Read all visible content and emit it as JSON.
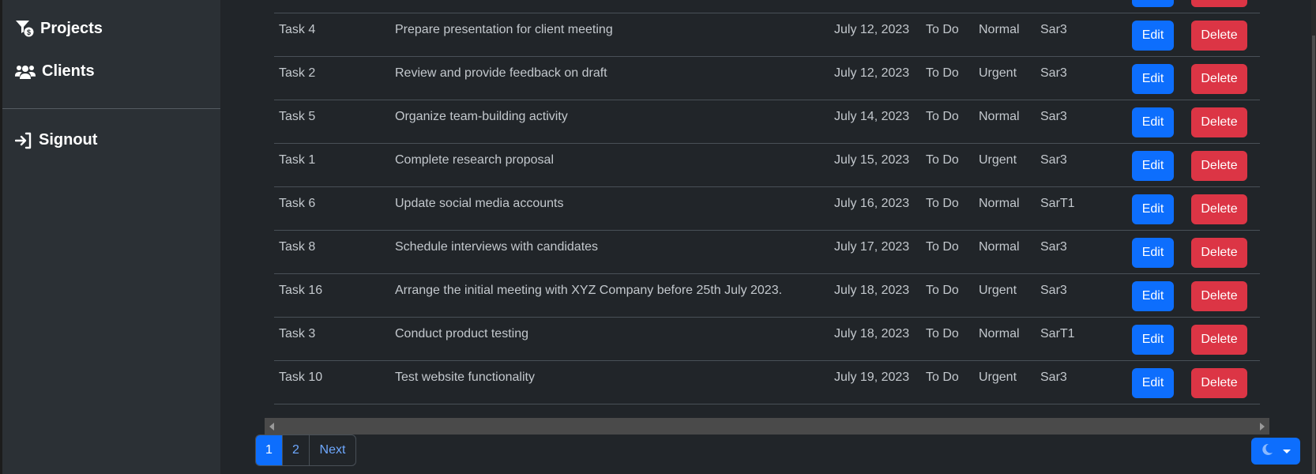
{
  "sidebar": {
    "items": [
      {
        "label": "Projects",
        "icon": "funnel-dollar-icon"
      },
      {
        "label": "Clients",
        "icon": "users-icon"
      },
      {
        "label": "Signout",
        "icon": "sign-in-icon"
      }
    ]
  },
  "table": {
    "rows": [
      {
        "name": "Task 4",
        "description": "Prepare presentation for client meeting",
        "due": "July 12, 2023",
        "status": "To Do",
        "priority": "Normal",
        "assignee": "Sar3"
      },
      {
        "name": "Task 2",
        "description": "Review and provide feedback on draft",
        "due": "July 12, 2023",
        "status": "To Do",
        "priority": "Urgent",
        "assignee": "Sar3"
      },
      {
        "name": "Task 5",
        "description": "Organize team-building activity",
        "due": "July 14, 2023",
        "status": "To Do",
        "priority": "Normal",
        "assignee": "Sar3"
      },
      {
        "name": "Task 1",
        "description": "Complete research proposal",
        "due": "July 15, 2023",
        "status": "To Do",
        "priority": "Urgent",
        "assignee": "Sar3"
      },
      {
        "name": "Task 6",
        "description": "Update social media accounts",
        "due": "July 16, 2023",
        "status": "To Do",
        "priority": "Normal",
        "assignee": "SarT1"
      },
      {
        "name": "Task 8",
        "description": "Schedule interviews with candidates",
        "due": "July 17, 2023",
        "status": "To Do",
        "priority": "Normal",
        "assignee": "Sar3"
      },
      {
        "name": "Task 16",
        "description": "Arrange the initial meeting with XYZ Company before 25th July 2023.",
        "due": "July 18, 2023",
        "status": "To Do",
        "priority": "Urgent",
        "assignee": "Sar3"
      },
      {
        "name": "Task 3",
        "description": "Conduct product testing",
        "due": "July 18, 2023",
        "status": "To Do",
        "priority": "Normal",
        "assignee": "SarT1"
      },
      {
        "name": "Task 10",
        "description": "Test website functionality",
        "due": "July 19, 2023",
        "status": "To Do",
        "priority": "Urgent",
        "assignee": "Sar3"
      }
    ],
    "edit_label": "Edit",
    "delete_label": "Delete"
  },
  "pagination": {
    "pages": [
      "1",
      "2"
    ],
    "active": "1",
    "next_label": "Next"
  },
  "theme_toggle": {
    "icon": "moon-icon",
    "mode": "dark"
  },
  "colors": {
    "primary": "#0d6efd",
    "danger": "#dc3545",
    "background": "#212529",
    "sidebar": "#2b3035"
  }
}
